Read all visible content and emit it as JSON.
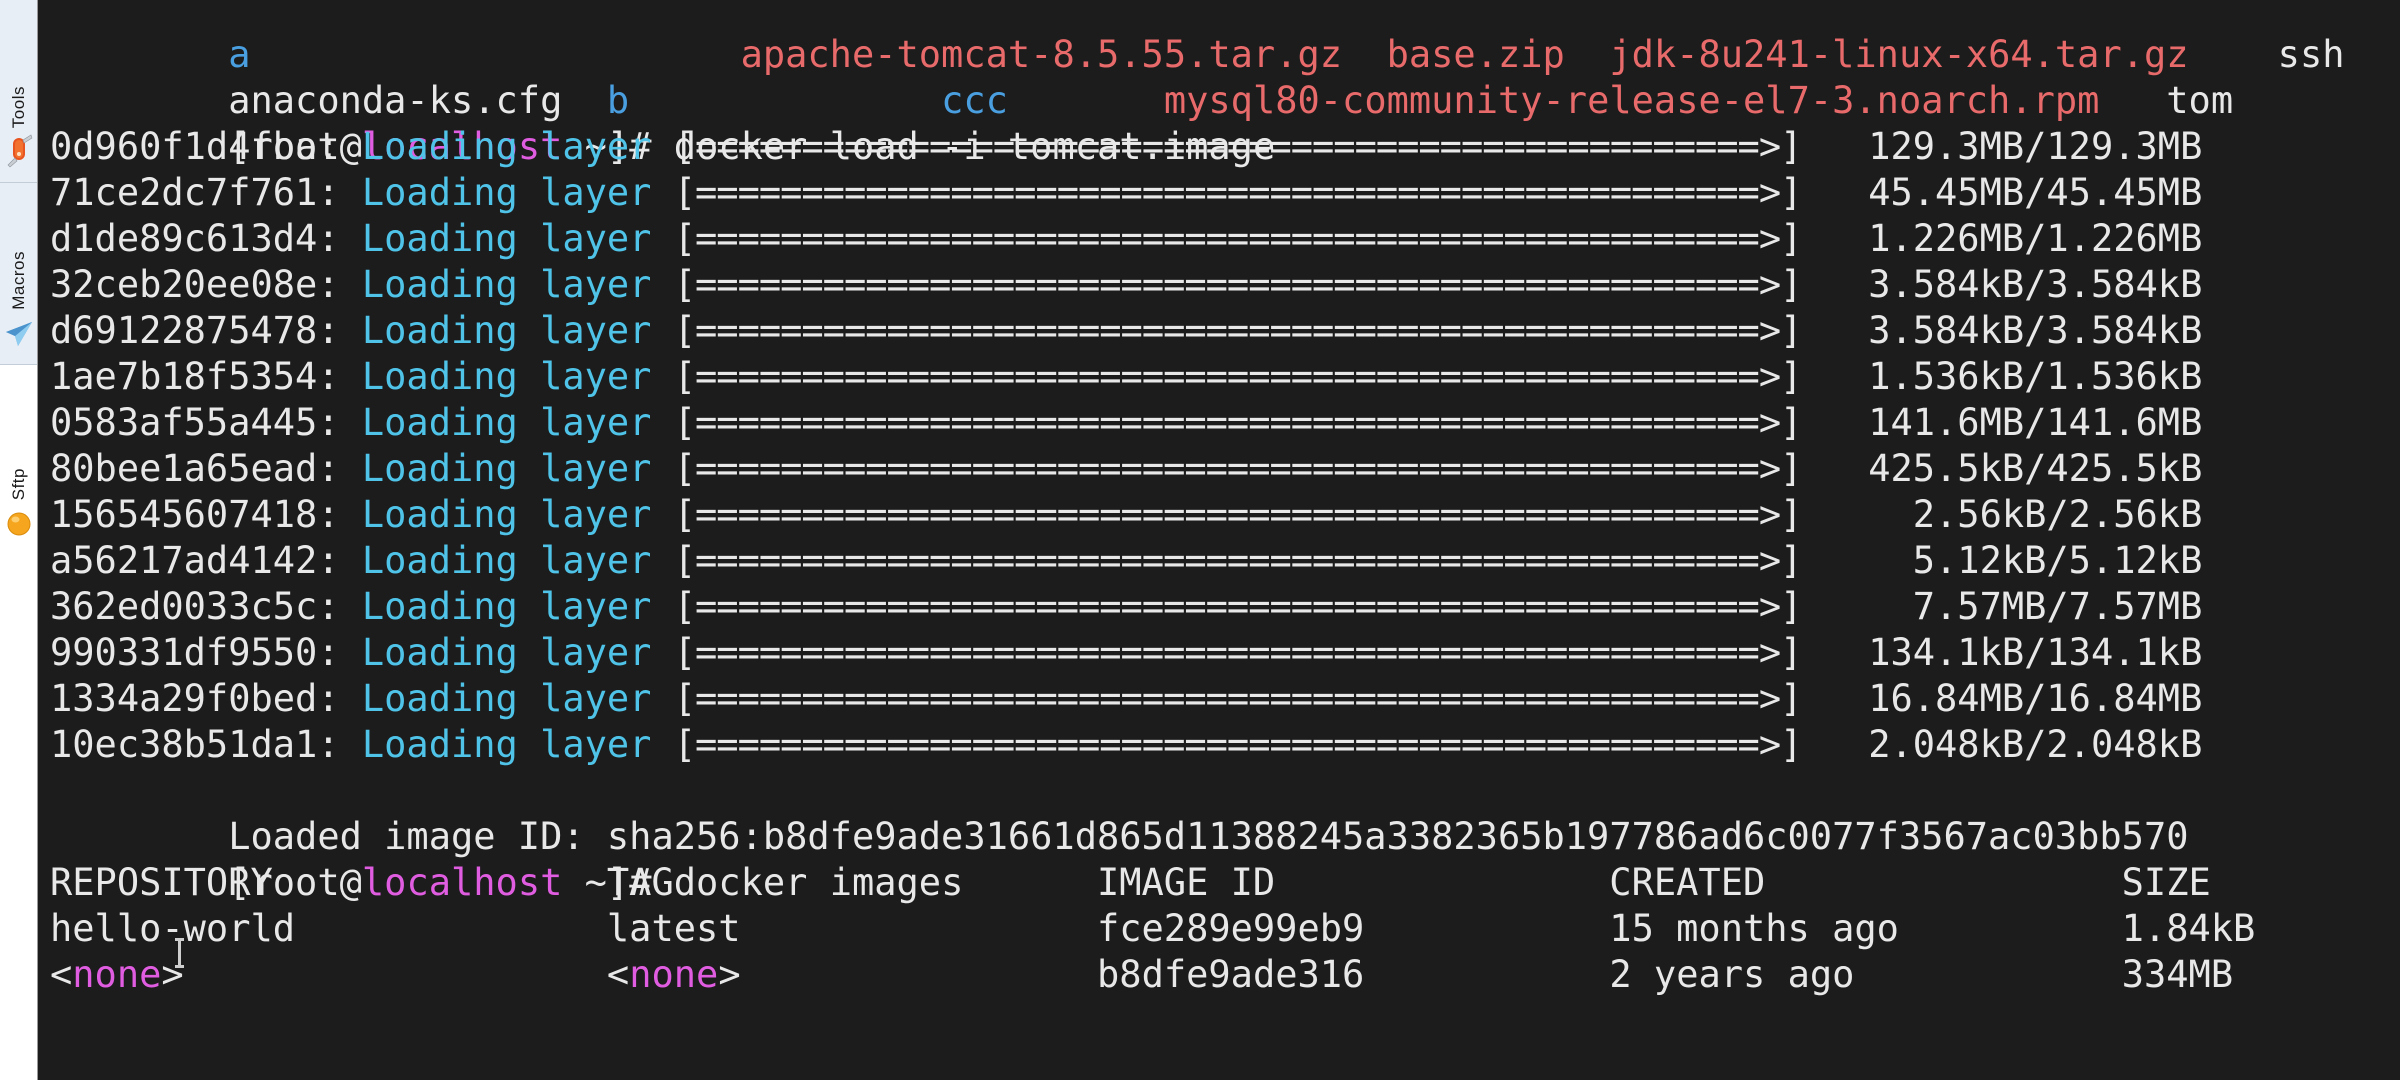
{
  "sidebar": {
    "items": [
      {
        "label": "Tools",
        "icon": "swiss-army-knife-icon"
      },
      {
        "label": "Macros",
        "icon": "paper-plane-icon"
      },
      {
        "label": "Sftp",
        "icon": "orange-sphere-icon"
      }
    ]
  },
  "terminal": {
    "prompt_user": "root",
    "prompt_host": "localhost",
    "prompt_prefix": "[root@",
    "prompt_at": "@",
    "prompt_suffix": " ~]# ",
    "bracket_open": "[",
    "bracket_close": "]",
    "tilde_hash": " ~]# ",
    "partial_top_row": {
      "col1": "a",
      "col2": "apache-tomcat-8.5.55.tar.gz",
      "col3": "base.zip",
      "col4": "jdk-8u241-linux-x64.tar.gz",
      "col5": "ssh"
    },
    "listing_row": {
      "col1": "anaconda-ks.cfg",
      "col2": "b",
      "col3": "ccc",
      "col4": "mysql80-community-release-el7-3.noarch.rpm",
      "col5": "tom"
    },
    "command_1": "docker load -i tomcat.image",
    "command_2": "docker images",
    "loading_label": "Loading layer",
    "progress_bar": "[==================================================>]",
    "layers": [
      {
        "id": "0d960f1d4fba",
        "size": "129.3MB/129.3MB"
      },
      {
        "id": "71ce2dc7f761",
        "size": "45.45MB/45.45MB"
      },
      {
        "id": "d1de89c613d4",
        "size": "1.226MB/1.226MB"
      },
      {
        "id": "32ceb20ee08e",
        "size": "3.584kB/3.584kB"
      },
      {
        "id": "d69122875478",
        "size": "3.584kB/3.584kB"
      },
      {
        "id": "1ae7b18f5354",
        "size": "1.536kB/1.536kB"
      },
      {
        "id": "0583af55a445",
        "size": "141.6MB/141.6MB"
      },
      {
        "id": "80bee1a65ead",
        "size": "425.5kB/425.5kB"
      },
      {
        "id": "156545607418",
        "size": "2.56kB/2.56kB"
      },
      {
        "id": "a56217ad4142",
        "size": "5.12kB/5.12kB"
      },
      {
        "id": "362ed0033c5c",
        "size": "7.57MB/7.57MB"
      },
      {
        "id": "990331df9550",
        "size": "134.1kB/134.1kB"
      },
      {
        "id": "1334a29f0bed",
        "size": "16.84MB/16.84MB"
      },
      {
        "id": "10ec38b51da1",
        "size": "2.048kB/2.048kB"
      }
    ],
    "loaded_image_line": "Loaded image ID: sha256:b8dfe9ade31661d865d11388245a3382365b197786ad6c0077f3567ac03bb570",
    "images_table": {
      "headers": {
        "repository": "REPOSITORY",
        "tag": "TAG",
        "image_id": "IMAGE ID",
        "created": "CREATED",
        "size": "SIZE"
      },
      "rows": [
        {
          "repository": "hello-world",
          "tag": "latest",
          "image_id": "fce289e99eb9",
          "created": "15 months ago",
          "size": "1.84kB"
        },
        {
          "repository": "<none>",
          "repository_inner": "none",
          "tag": "<none>",
          "tag_inner": "none",
          "image_id": "b8dfe9ade316",
          "created": "2 years ago",
          "size": "334MB"
        }
      ]
    }
  },
  "colors": {
    "background": "#1c1c1c",
    "foreground": "#e8e8e8",
    "cyan": "#4fc3e8",
    "magenta": "#ff4fd8",
    "red": "#e86a6a",
    "blue": "#4a9fe0",
    "sidebar_bg": "#f2f2f2"
  }
}
